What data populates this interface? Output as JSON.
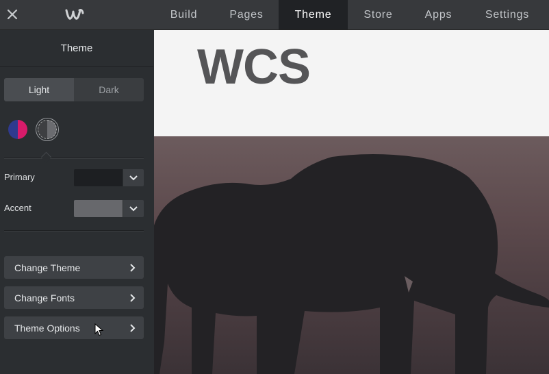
{
  "topbar": {
    "nav": [
      {
        "label": "Build",
        "active": false
      },
      {
        "label": "Pages",
        "active": false
      },
      {
        "label": "Theme",
        "active": true
      },
      {
        "label": "Store",
        "active": false
      },
      {
        "label": "Apps",
        "active": false
      },
      {
        "label": "Settings",
        "active": false
      }
    ]
  },
  "sidebar": {
    "title": "Theme",
    "mode": {
      "light": "Light",
      "dark": "Dark",
      "selected": "Light"
    },
    "swatches": [
      "blue-magenta",
      "dark-gray"
    ],
    "primary_label": "Primary",
    "primary_color": "#1d1f22",
    "accent_label": "Accent",
    "accent_color": "#67686c",
    "buttons": [
      "Change Theme",
      "Change Fonts",
      "Theme Options"
    ]
  },
  "preview": {
    "site_title": "WCS",
    "hero_subject": "elephant"
  }
}
